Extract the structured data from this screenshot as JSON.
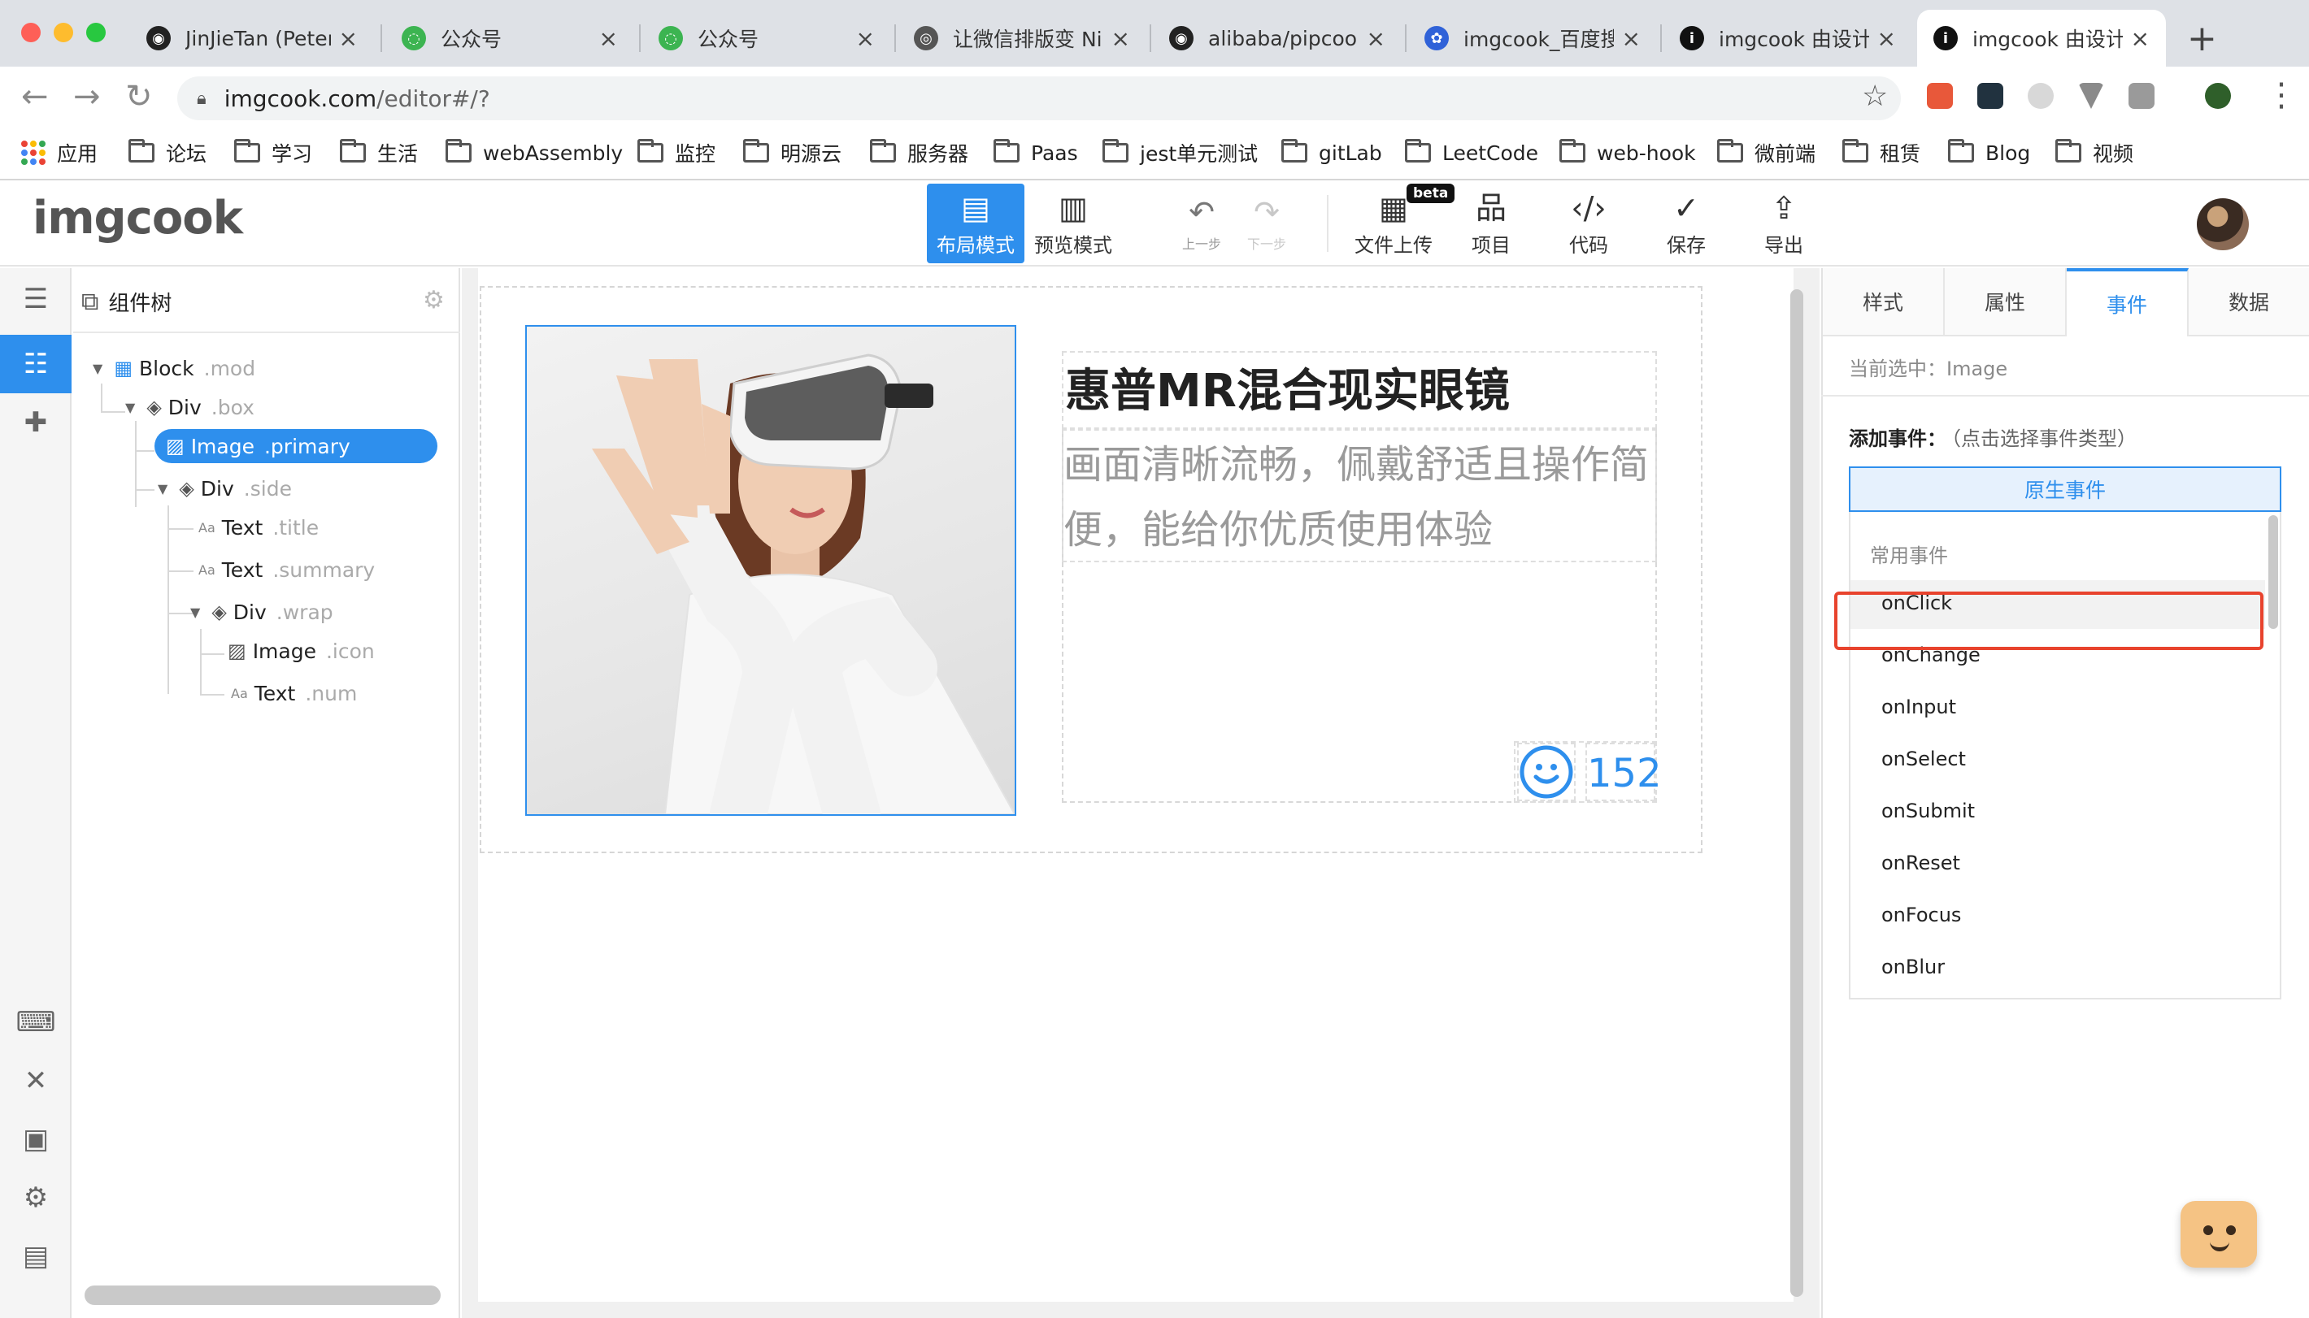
{
  "browser": {
    "tabs": [
      {
        "title": "JinJieTan (Peter)",
        "icon": "github-icon"
      },
      {
        "title": "公众号",
        "icon": "wechat-icon"
      },
      {
        "title": "公众号",
        "icon": "wechat-icon"
      },
      {
        "title": "让微信排版变 Nic",
        "icon": "globe-icon"
      },
      {
        "title": "alibaba/pipcook",
        "icon": "github-icon"
      },
      {
        "title": "imgcook_百度搜",
        "icon": "baidu-icon"
      },
      {
        "title": "imgcook 由设计和",
        "icon": "info-icon"
      },
      {
        "title": "imgcook 由设计和",
        "icon": "info-icon",
        "active": true
      }
    ],
    "close_glyph": "×",
    "new_tab_glyph": "+",
    "url_host": "imgcook.com",
    "url_path": "/editor#/?",
    "bookmarks": [
      "应用",
      "论坛",
      "学习",
      "生活",
      "webAssembly",
      "监控",
      "明源云",
      "服务器",
      "Paas",
      "jest单元测试",
      "gitLab",
      "LeetCode",
      "web-hook",
      "微前端",
      "租赁",
      "Blog",
      "视频"
    ]
  },
  "app": {
    "logo": "imgcook",
    "toolbar": {
      "layout_mode": "布局模式",
      "preview_mode": "预览模式",
      "undo": "上一步",
      "redo": "下一步",
      "upload": "文件上传",
      "beta": "beta",
      "project": "项目",
      "code": "代码",
      "save": "保存",
      "export": "导出"
    }
  },
  "tree": {
    "title": "组件树",
    "nodes": [
      {
        "type": "Block",
        "cls": ".mod"
      },
      {
        "type": "Div",
        "cls": ".box"
      },
      {
        "type": "Image",
        "cls": ".primary"
      },
      {
        "type": "Div",
        "cls": ".side"
      },
      {
        "type": "Text",
        "cls": ".title"
      },
      {
        "type": "Text",
        "cls": ".summary"
      },
      {
        "type": "Div",
        "cls": ".wrap"
      },
      {
        "type": "Image",
        "cls": ".icon"
      },
      {
        "type": "Text",
        "cls": ".num"
      }
    ]
  },
  "canvas": {
    "title": "惠普MR混合现实眼镜",
    "summary": "画面清晰流畅，佩戴舒适且操作简便，能给你优质使用体验",
    "num": "152"
  },
  "panel": {
    "tabs": [
      "样式",
      "属性",
      "事件",
      "数据"
    ],
    "active_tab": "事件",
    "current_selection": "当前选中：Image",
    "add_event_label": "添加事件：",
    "add_event_hint": "（点击选择事件类型）",
    "native_event_button": "原生事件",
    "group_label": "常用事件",
    "events": [
      "onClick",
      "onChange",
      "onInput",
      "onSelect",
      "onSubmit",
      "onReset",
      "onFocus",
      "onBlur"
    ],
    "highlight_color": "#e8432d"
  },
  "colors": {
    "accent": "#2e8fed"
  }
}
